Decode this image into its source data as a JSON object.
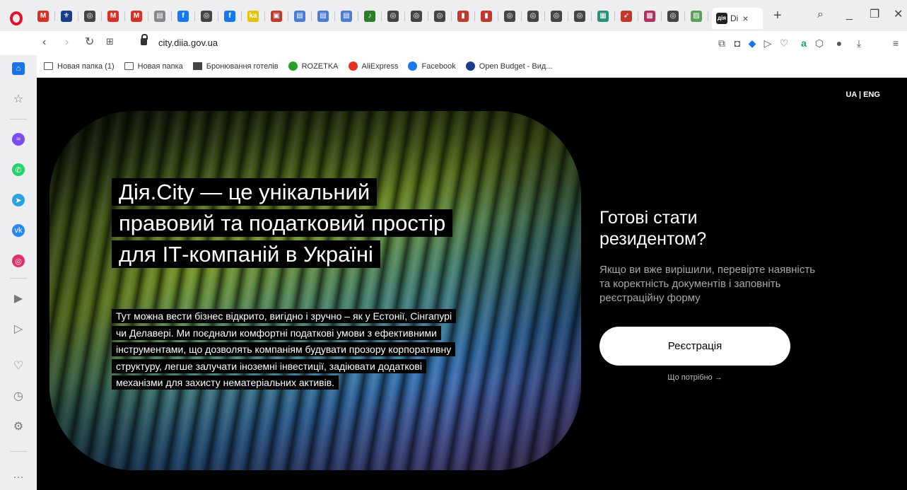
{
  "browser": {
    "tabs": [
      {
        "icon": "gmail",
        "color": "#d93025",
        "glyph": "M"
      },
      {
        "icon": "trident",
        "color": "#1a3c8a",
        "glyph": "⚜"
      },
      {
        "icon": "opera-globe",
        "color": "#444",
        "glyph": "◎"
      },
      {
        "icon": "gmail",
        "color": "#d93025",
        "glyph": "M"
      },
      {
        "icon": "gmail",
        "color": "#d93025",
        "glyph": "M"
      },
      {
        "icon": "page",
        "color": "#888",
        "glyph": "▤"
      },
      {
        "icon": "facebook",
        "color": "#1877f2",
        "glyph": "f"
      },
      {
        "icon": "opera-globe",
        "color": "#444",
        "glyph": "◎"
      },
      {
        "icon": "facebook",
        "color": "#1877f2",
        "glyph": "f"
      },
      {
        "icon": "ka",
        "color": "#e7c200",
        "glyph": "ka"
      },
      {
        "icon": "cube",
        "color": "#c0392b",
        "glyph": "▣"
      },
      {
        "icon": "docs",
        "color": "#4a7bd6",
        "glyph": "▤"
      },
      {
        "icon": "docs",
        "color": "#4a7bd6",
        "glyph": "▤"
      },
      {
        "icon": "docs",
        "color": "#4a7bd6",
        "glyph": "▤"
      },
      {
        "icon": "audio",
        "color": "#2d7d2d",
        "glyph": "♪"
      },
      {
        "icon": "opera-globe",
        "color": "#444",
        "glyph": "◎"
      },
      {
        "icon": "opera-globe",
        "color": "#444",
        "glyph": "◎"
      },
      {
        "icon": "opera-globe",
        "color": "#444",
        "glyph": "◎"
      },
      {
        "icon": "flag",
        "color": "#c0392b",
        "glyph": "▮"
      },
      {
        "icon": "flag",
        "color": "#c0392b",
        "glyph": "▮"
      },
      {
        "icon": "opera-globe",
        "color": "#444",
        "glyph": "◎"
      },
      {
        "icon": "opera-globe",
        "color": "#444",
        "glyph": "◎"
      },
      {
        "icon": "opera-globe",
        "color": "#444",
        "glyph": "◎"
      },
      {
        "icon": "opera-globe",
        "color": "#444",
        "glyph": "◎"
      },
      {
        "icon": "chart",
        "color": "#2a8f7a",
        "glyph": "▦"
      },
      {
        "icon": "rocket",
        "color": "#c0392b",
        "glyph": "➶"
      },
      {
        "icon": "image",
        "color": "#b03060",
        "glyph": "▩"
      },
      {
        "icon": "opera-globe",
        "color": "#444",
        "glyph": "◎"
      },
      {
        "icon": "pattern",
        "color": "#5aa05a",
        "glyph": "▨"
      }
    ],
    "active_tab": {
      "favicon": "дія",
      "title": "Di",
      "close": "×"
    },
    "new_tab": "+",
    "address": {
      "url": "city.diia.gov.ua"
    }
  },
  "bookmarks": [
    {
      "label": "Новая папка (1)",
      "icon": "folder"
    },
    {
      "label": "Новая папка",
      "icon": "folder"
    },
    {
      "label": "Бронювання готелів",
      "icon": "doc"
    },
    {
      "label": "ROZETKA",
      "icon": "rozetka",
      "color": "#2a9d2a"
    },
    {
      "label": "AliExpress",
      "icon": "aliexpress",
      "color": "#e43225"
    },
    {
      "label": "Facebook",
      "icon": "facebook",
      "color": "#1877f2"
    },
    {
      "label": "Open Budget - Вид...",
      "icon": "openbudget",
      "color": "#1a3c8a"
    }
  ],
  "sidebar": [
    {
      "icon": "home-icon",
      "color": "#1a73e8",
      "glyph": "⌂"
    },
    {
      "icon": "star-icon",
      "color": "",
      "glyph": "☆"
    },
    {
      "icon": "messenger-icon",
      "color": "#7b4cf5",
      "glyph": "≈"
    },
    {
      "icon": "whatsapp-icon",
      "color": "#25d366",
      "glyph": "✆"
    },
    {
      "icon": "telegram-icon",
      "color": "#2aa3e0",
      "glyph": "➤"
    },
    {
      "icon": "vk-icon",
      "color": "#2787f5",
      "glyph": "vk"
    },
    {
      "icon": "instagram-icon",
      "color": "#e1306c",
      "glyph": "◎"
    },
    {
      "icon": "player-icon",
      "color": "",
      "glyph": "▶"
    },
    {
      "icon": "send-icon",
      "color": "",
      "glyph": "▷"
    },
    {
      "icon": "heart-icon",
      "color": "",
      "glyph": "♡"
    },
    {
      "icon": "history-icon",
      "color": "",
      "glyph": "◷"
    },
    {
      "icon": "settings-icon",
      "color": "",
      "glyph": "⚙"
    },
    {
      "icon": "more-icon",
      "color": "",
      "glyph": "…"
    }
  ],
  "page": {
    "lang": "UA | ENG",
    "hero": {
      "headline": "Дія.City — це унікальний правовий та податковий простір для ІТ-компаній в Україні",
      "lead": "Тут можна вести бізнес відкрито, вигідно і зручно – як у Естонії, Сінгапурі чи Делавері. Ми поєднали комфортні податкові умови з ефективними інструментами, що дозволять компаніям  будувати прозору корпоративну структуру, легше залучати іноземні інвестиції, задіювати додаткові механізми для захисту нематеріальних активів."
    },
    "cta": {
      "title": "Готові стати резидентом?",
      "description": "Якщо ви вже вирішили, перевірте наявність та коректність документів і заповніть реєстраційну форму",
      "button": "Реєстрація",
      "link": "Що потрібно →"
    }
  }
}
